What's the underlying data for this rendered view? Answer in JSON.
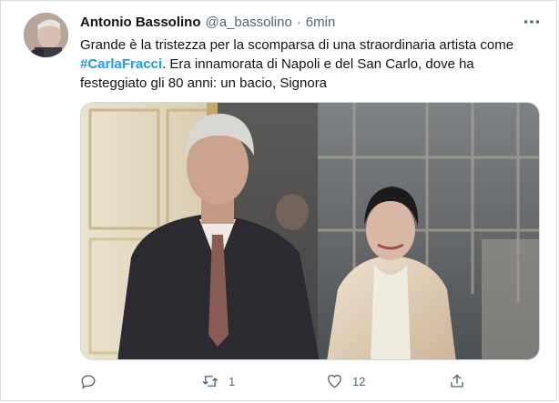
{
  "tweet": {
    "author_name": "Antonio Bassolino",
    "handle": "@a_bassolino",
    "separator": "·",
    "time": "6min",
    "text_before": "Grande è la tristezza per la scomparsa di una straordinaria artista come ",
    "hashtag": "#CarlaFracci",
    "text_after": ". Era innamorata di Napoli e del San Carlo, dove ha festeggiato gli 80 anni: un bacio, Signora",
    "more_icon": "ellipsis-icon",
    "media_alt": "photo"
  },
  "actions": {
    "reply": {
      "icon": "reply-icon",
      "count": ""
    },
    "retweet": {
      "icon": "retweet-icon",
      "count": "1"
    },
    "like": {
      "icon": "heart-icon",
      "count": "12"
    },
    "share": {
      "icon": "share-icon",
      "count": ""
    }
  },
  "colors": {
    "accent": "#1d9bf0",
    "text_primary": "#0f1419",
    "text_secondary": "#536471",
    "border": "#d9dde0"
  }
}
